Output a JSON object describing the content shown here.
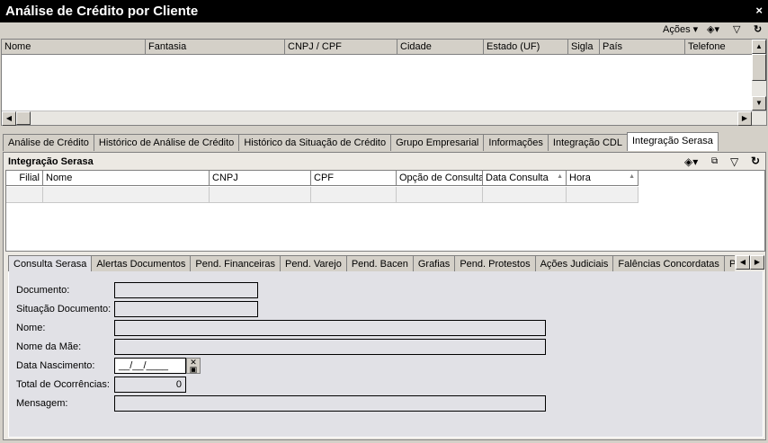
{
  "window": {
    "title": "Análise de Crédito por Cliente",
    "close": "×"
  },
  "toolbar": {
    "acoes": "Ações ▾",
    "view_icon": "◈▾",
    "filter_icon": "▽",
    "refresh_icon": "↻"
  },
  "grid_clientes": {
    "columns": [
      "Nome",
      "Fantasia",
      "CNPJ / CPF",
      "Cidade",
      "Estado (UF)",
      "Sigla",
      "País",
      "Telefone"
    ]
  },
  "main_tabs": [
    "Análise de Crédito",
    "Histórico de Análise de Crédito",
    "Histórico da Situação de Crédito",
    "Grupo Empresarial",
    "Informações",
    "Integração CDL",
    "Integração Serasa"
  ],
  "panel": {
    "title": "Integração Serasa",
    "columns": [
      "Filial",
      "Nome",
      "CNPJ",
      "CPF",
      "Opção de Consulta",
      "Data Consulta",
      "Hora"
    ]
  },
  "sub_tabs": [
    "Consulta Serasa",
    "Alertas Documentos",
    "Pend. Financeiras",
    "Pend. Varejo",
    "Pend. Bacen",
    "Grafias",
    "Pend. Protestos",
    "Ações Judiciais",
    "Falências Concordatas",
    "Partic"
  ],
  "form": {
    "documento": {
      "label": "Documento:",
      "value": ""
    },
    "situacao": {
      "label": "Situação Documento:",
      "value": ""
    },
    "nome": {
      "label": "Nome:",
      "value": ""
    },
    "nome_mae": {
      "label": "Nome da Mãe:",
      "value": ""
    },
    "data_nasc": {
      "label": "Data Nascimento:",
      "value": "__/__/____"
    },
    "total": {
      "label": "Total de Ocorrências:",
      "value": "0"
    },
    "mensagem": {
      "label": "Mensagem:",
      "value": ""
    }
  }
}
